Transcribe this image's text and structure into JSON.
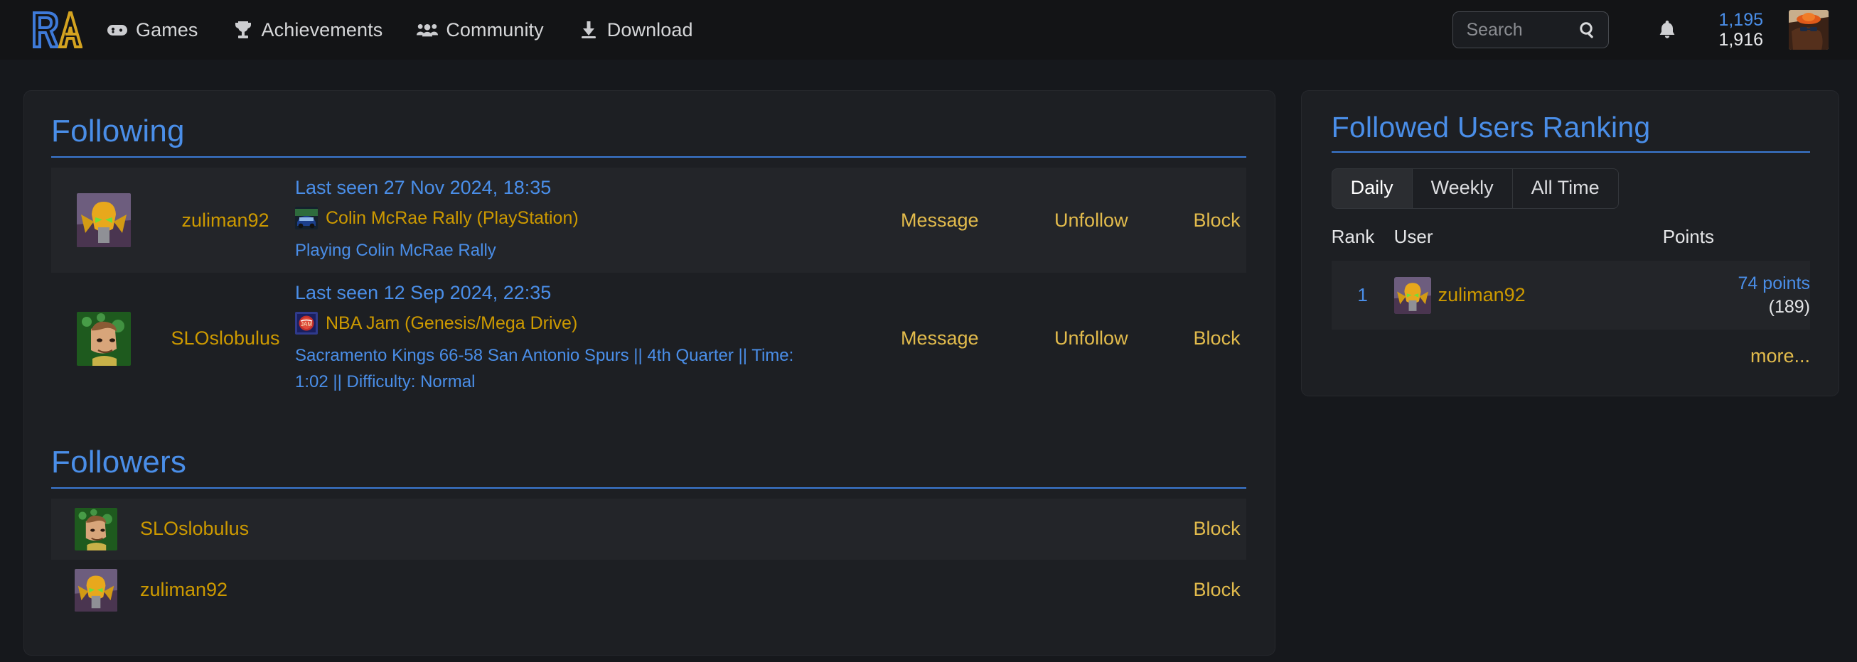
{
  "header": {
    "logo_alt": "RA",
    "nav": [
      {
        "label": "Games",
        "icon": "gamepad-icon"
      },
      {
        "label": "Achievements",
        "icon": "trophy-icon"
      },
      {
        "label": "Community",
        "icon": "users-icon"
      },
      {
        "label": "Download",
        "icon": "download-icon"
      }
    ],
    "search": {
      "placeholder": "Search",
      "value": ""
    },
    "points": {
      "hardcore": "1,195",
      "softcore": "1,916"
    }
  },
  "following": {
    "title": "Following",
    "rows": [
      {
        "username": "zuliman92",
        "last_seen": "Last seen 27 Nov 2024, 18:35",
        "game": "Colin McRae Rally (PlayStation)",
        "rich_presence": "Playing Colin McRae Rally",
        "actions": {
          "message": "Message",
          "unfollow": "Unfollow",
          "block": "Block"
        }
      },
      {
        "username": "SLOslobulus",
        "last_seen": "Last seen 12 Sep 2024, 22:35",
        "game": "NBA Jam (Genesis/Mega Drive)",
        "rich_presence": "Sacramento Kings 66-58 San Antonio Spurs || 4th Quarter || Time: 1:02 || Difficulty: Normal",
        "actions": {
          "message": "Message",
          "unfollow": "Unfollow",
          "block": "Block"
        }
      }
    ]
  },
  "followers": {
    "title": "Followers",
    "rows": [
      {
        "username": "SLOslobulus",
        "block": "Block"
      },
      {
        "username": "zuliman92",
        "block": "Block"
      }
    ]
  },
  "ranking": {
    "title": "Followed Users Ranking",
    "tabs": [
      {
        "label": "Daily",
        "active": true
      },
      {
        "label": "Weekly",
        "active": false
      },
      {
        "label": "All Time",
        "active": false
      }
    ],
    "columns": {
      "rank": "Rank",
      "user": "User",
      "points": "Points"
    },
    "rows": [
      {
        "rank": "1",
        "username": "zuliman92",
        "points": "74 points",
        "points_sub": "(189)"
      }
    ],
    "more_label": "more..."
  },
  "colors": {
    "accent_blue": "#4a8ee8",
    "accent_gold": "#cc9900",
    "link_gold": "#e2bb4c",
    "page_bg": "#16181c",
    "card_bg": "#1d1f23",
    "row_alt_bg": "#232529",
    "header_bg": "#131416"
  }
}
